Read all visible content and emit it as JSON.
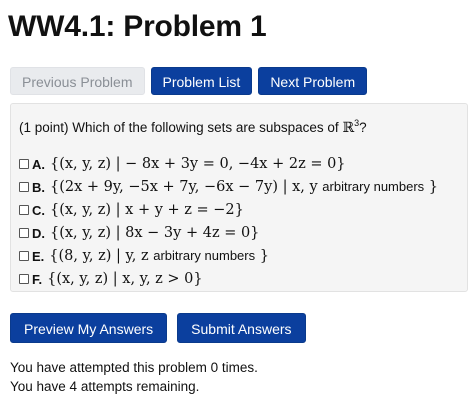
{
  "page": {
    "title": "WW4.1: Problem 1"
  },
  "nav": {
    "previous_label": "Previous Problem",
    "list_label": "Problem List",
    "next_label": "Next Problem"
  },
  "problem": {
    "points": "(1 point)",
    "question": "Which of the following sets are subspaces of",
    "space_symbol": "ℝ",
    "space_exponent": "3",
    "question_end": "?",
    "options": [
      {
        "label": "A.",
        "math": "{(x, y, z) | − 8x + 3y = 0, −4x + 2z = 0}",
        "text_after": ""
      },
      {
        "label": "B.",
        "math": "{(2x + 9y, −5x + 7y, −6x − 7y) | x, y",
        "text_after": "arbitrary numbers",
        "math_end": "}"
      },
      {
        "label": "C.",
        "math": "{(x, y, z) | x + y + z = −2}",
        "text_after": ""
      },
      {
        "label": "D.",
        "math": "{(x, y, z) | 8x − 3y + 4z = 0}",
        "text_after": ""
      },
      {
        "label": "E.",
        "math": "{(8, y, z) | y, z",
        "text_after": "arbitrary numbers",
        "math_end": "}"
      },
      {
        "label": "F.",
        "math": "{(x, y, z) | x, y, z > 0}",
        "text_after": ""
      }
    ]
  },
  "actions": {
    "preview_label": "Preview My Answers",
    "submit_label": "Submit Answers"
  },
  "status": {
    "attempted": "You have attempted this problem 0 times.",
    "remaining": "You have 4 attempts remaining."
  },
  "colors": {
    "primary_button": "#0b3f9e",
    "disabled_button": "#e9ebee",
    "problem_background": "#f5f5f5"
  }
}
